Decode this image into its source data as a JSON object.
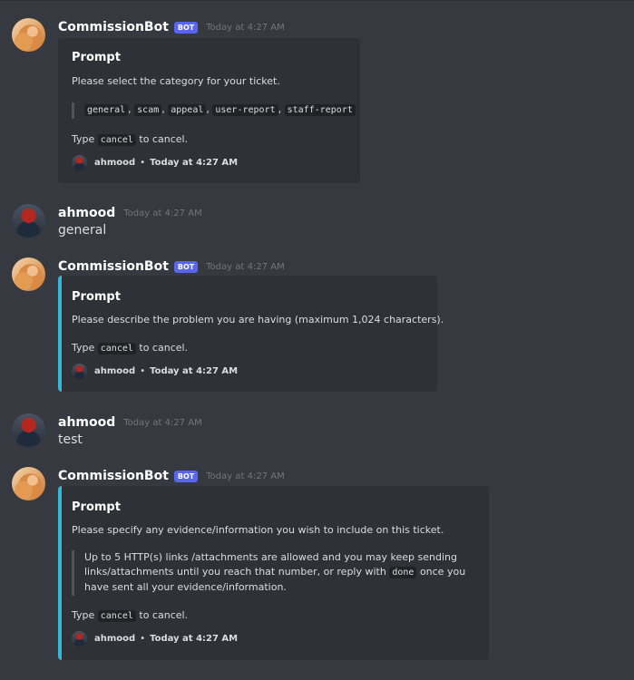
{
  "bot": {
    "name": "CommissionBot",
    "tag": "BOT"
  },
  "user": {
    "name": "ahmood"
  },
  "messages": [
    {
      "timestamp": "Today at 4:27 AM",
      "embed": {
        "title": "Prompt",
        "description": "Please select the category for your ticket.",
        "categories": [
          "general",
          "scam",
          "appeal",
          "user-report",
          "staff-report"
        ],
        "cancel_prefix": "Type",
        "cancel_code": "cancel",
        "cancel_suffix": "to cancel.",
        "footer_name": "ahmood",
        "footer_time": "Today at 4:27 AM"
      }
    },
    {
      "timestamp": "Today at 4:27 AM",
      "text": "general"
    },
    {
      "timestamp": "Today at 4:27 AM",
      "embed": {
        "title": "Prompt",
        "description": "Please describe the problem you are having (maximum 1,024 characters).",
        "cancel_prefix": "Type",
        "cancel_code": "cancel",
        "cancel_suffix": "to cancel.",
        "footer_name": "ahmood",
        "footer_time": "Today at 4:27 AM"
      }
    },
    {
      "timestamp": "Today at 4:27 AM",
      "text": "test"
    },
    {
      "timestamp": "Today at 4:27 AM",
      "embed": {
        "title": "Prompt",
        "description": "Please specify any evidence/information you wish to include on this ticket.",
        "quote_line1": "Up to 5 HTTP(s) links /attachments are allowed and you may keep sending",
        "quote_line2_pre": "links/attachments until you reach that number, or reply with",
        "quote_code": "done",
        "quote_line2_post": "once you",
        "quote_line3": "have sent all your evidence/information.",
        "cancel_prefix": "Type",
        "cancel_code": "cancel",
        "cancel_suffix": "to cancel.",
        "footer_name": "ahmood",
        "footer_time": "Today at 4:27 AM"
      }
    }
  ],
  "colors": {
    "background": "#36393f",
    "embed_bg": "#2f3136",
    "embed_accent": "#36b5d8",
    "bot_tag": "#5865f2"
  }
}
